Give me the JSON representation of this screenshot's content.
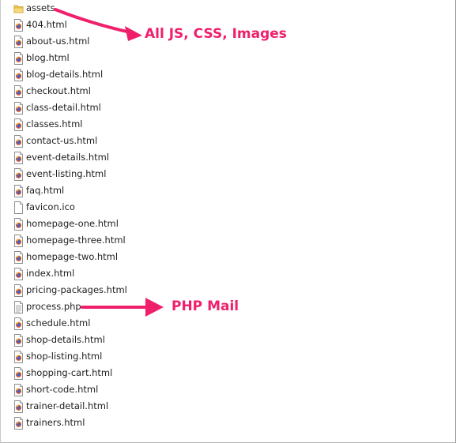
{
  "files": [
    {
      "name": "assets",
      "type": "folder",
      "icon": "folder-icon"
    },
    {
      "name": "404.html",
      "type": "html",
      "icon": "html-file-icon"
    },
    {
      "name": "about-us.html",
      "type": "html",
      "icon": "html-file-icon"
    },
    {
      "name": "blog.html",
      "type": "html",
      "icon": "html-file-icon"
    },
    {
      "name": "blog-details.html",
      "type": "html",
      "icon": "html-file-icon"
    },
    {
      "name": "checkout.html",
      "type": "html",
      "icon": "html-file-icon"
    },
    {
      "name": "class-detail.html",
      "type": "html",
      "icon": "html-file-icon"
    },
    {
      "name": "classes.html",
      "type": "html",
      "icon": "html-file-icon"
    },
    {
      "name": "contact-us.html",
      "type": "html",
      "icon": "html-file-icon"
    },
    {
      "name": "event-details.html",
      "type": "html",
      "icon": "html-file-icon"
    },
    {
      "name": "event-listing.html",
      "type": "html",
      "icon": "html-file-icon"
    },
    {
      "name": "faq.html",
      "type": "html",
      "icon": "html-file-icon"
    },
    {
      "name": "favicon.ico",
      "type": "blank",
      "icon": "blank-file-icon"
    },
    {
      "name": "homepage-one.html",
      "type": "html",
      "icon": "html-file-icon"
    },
    {
      "name": "homepage-three.html",
      "type": "html",
      "icon": "html-file-icon"
    },
    {
      "name": "homepage-two.html",
      "type": "html",
      "icon": "html-file-icon"
    },
    {
      "name": "index.html",
      "type": "html",
      "icon": "html-file-icon"
    },
    {
      "name": "pricing-packages.html",
      "type": "html",
      "icon": "html-file-icon"
    },
    {
      "name": "process.php",
      "type": "text",
      "icon": "text-file-icon"
    },
    {
      "name": "schedule.html",
      "type": "html",
      "icon": "html-file-icon"
    },
    {
      "name": "shop-details.html",
      "type": "html",
      "icon": "html-file-icon"
    },
    {
      "name": "shop-listing.html",
      "type": "html",
      "icon": "html-file-icon"
    },
    {
      "name": "shopping-cart.html",
      "type": "html",
      "icon": "html-file-icon"
    },
    {
      "name": "short-code.html",
      "type": "html",
      "icon": "html-file-icon"
    },
    {
      "name": "trainer-detail.html",
      "type": "html",
      "icon": "html-file-icon"
    },
    {
      "name": "trainers.html",
      "type": "html",
      "icon": "html-file-icon"
    }
  ],
  "annotations": {
    "assets_label": "All JS, CSS, Images",
    "php_label": "PHP Mail",
    "color": "#ef1f6c"
  }
}
